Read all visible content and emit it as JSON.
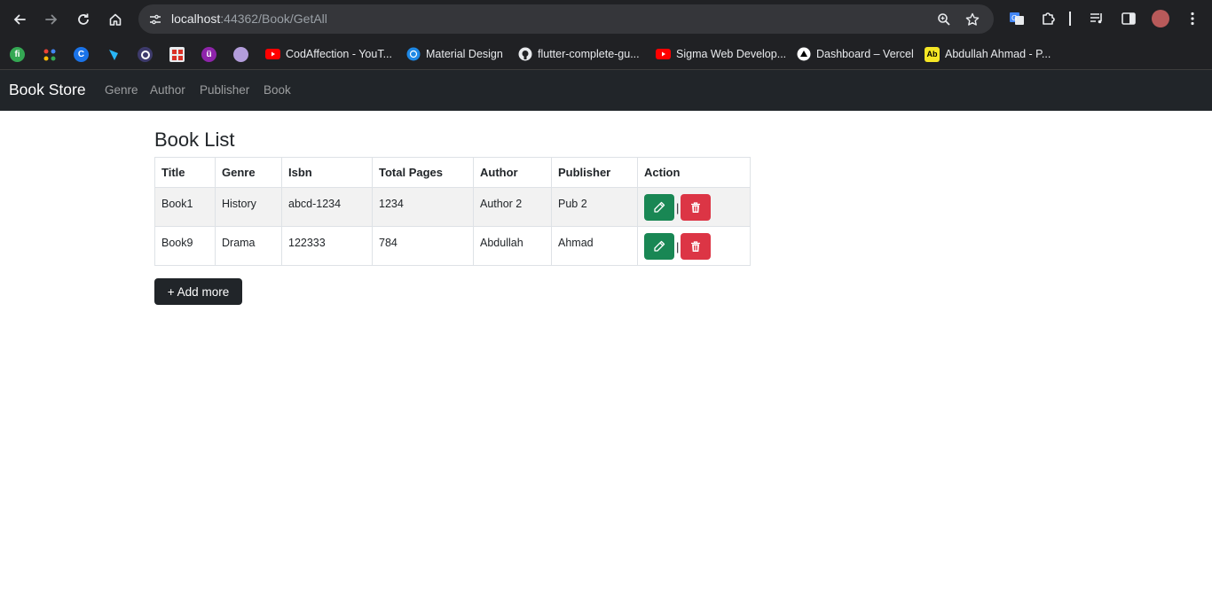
{
  "browser": {
    "url_host": "localhost",
    "url_path": ":44362/Book/GetAll",
    "bookmarks": [
      {
        "label": "CodAffection - YouT...",
        "icon": "youtube-icon"
      },
      {
        "label": "Material Design",
        "icon": "material-icon"
      },
      {
        "label": "flutter-complete-gu...",
        "icon": "github-icon"
      },
      {
        "label": "Sigma Web Develop...",
        "icon": "youtube-icon"
      },
      {
        "label": "Dashboard – Vercel",
        "icon": "vercel-icon"
      },
      {
        "label": "Abdullah Ahmad - P...",
        "icon": "ab-icon"
      }
    ]
  },
  "navbar": {
    "brand": "Book Store",
    "links": [
      "Genre",
      "Author",
      "Publisher",
      "Book"
    ]
  },
  "page": {
    "title": "Book List",
    "add_button": "+ Add more"
  },
  "table": {
    "headers": [
      "Title",
      "Genre",
      "Isbn",
      "Total Pages",
      "Author",
      "Publisher",
      "Action"
    ],
    "rows": [
      [
        "Book1",
        "History",
        "abcd-1234",
        "1234",
        "Author 2",
        "Pub 2"
      ],
      [
        "Book9",
        "Drama",
        "122333",
        "784",
        "Abdullah",
        "Ahmad"
      ]
    ],
    "separator": "|"
  },
  "colors": {
    "edit": "#198754",
    "delete": "#dc3545",
    "navbar_bg": "#212529"
  }
}
